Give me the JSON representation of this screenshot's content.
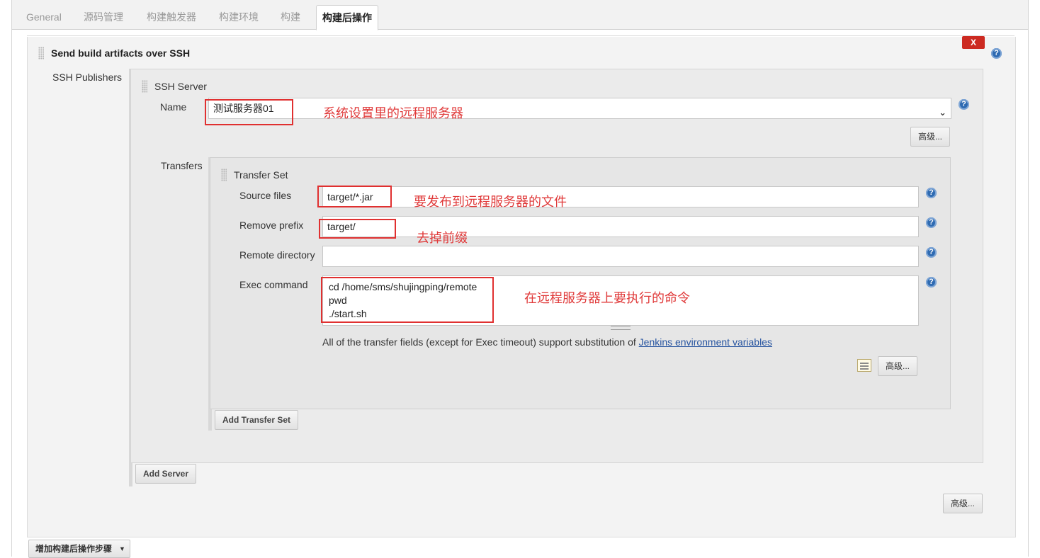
{
  "tabs": [
    {
      "label": "General"
    },
    {
      "label": "源码管理"
    },
    {
      "label": "构建触发器"
    },
    {
      "label": "构建环境"
    },
    {
      "label": "构建"
    },
    {
      "label": "构建后操作"
    }
  ],
  "section": {
    "title": "Send build artifacts over SSH",
    "delete_label": "X",
    "publishers_label": "SSH Publishers"
  },
  "ssh_server": {
    "title": "SSH Server",
    "name_label": "Name",
    "name_value": "测试服务器01",
    "advanced_label": "高级...",
    "transfers_label": "Transfers"
  },
  "transfer_set": {
    "title": "Transfer Set",
    "source_files_label": "Source files",
    "source_files_value": "target/*.jar",
    "remove_prefix_label": "Remove prefix",
    "remove_prefix_value": "target/",
    "remote_directory_label": "Remote directory",
    "remote_directory_value": "",
    "exec_command_label": "Exec command",
    "exec_command_value": "cd /home/sms/shujingping/remote\npwd\n./start.sh",
    "note_text": "All of the transfer fields (except for Exec timeout) support substitution of ",
    "note_link": "Jenkins environment variables",
    "advanced_label": "高级..."
  },
  "buttons": {
    "add_transfer_set": "Add Transfer Set",
    "add_server": "Add Server",
    "section_advanced": "高级...",
    "add_post_build_step": "增加构建后操作步骤"
  },
  "help_glyph": "?",
  "annotations": {
    "name": "系统设置里的远程服务器",
    "source_files": "要发布到远程服务器的文件",
    "remove_prefix": "去掉前缀",
    "exec_command": "在远程服务器上要执行的命令"
  },
  "colors": {
    "annotation_red": "#e03030",
    "help_blue": "#2f6bb2",
    "delete_red": "#cc2a21",
    "link_blue": "#2754a0"
  },
  "icons": {
    "help": "question-circle-icon",
    "delete": "close-icon",
    "drag": "drag-handle-icon",
    "notepad": "notepad-pencil-icon",
    "dropdown": "chevron-down-icon"
  }
}
